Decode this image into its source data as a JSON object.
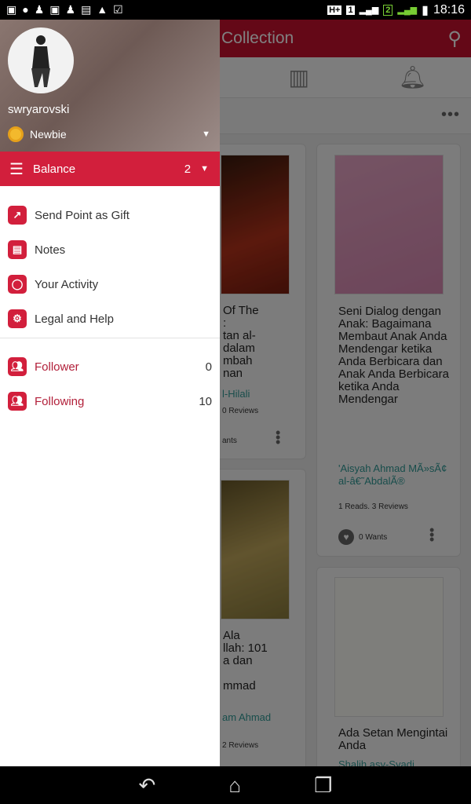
{
  "status_bar": {
    "time": "18:16",
    "network": "H+",
    "sim1": "1",
    "sim2": "2"
  },
  "app": {
    "title": "Collection",
    "tabs": [
      "home-icon",
      "chart-icon",
      "bell-icon"
    ]
  },
  "books": [
    {
      "title_lines": [
        "Of The",
        ":",
        "tan al-",
        "dalam",
        "mbah",
        "nan"
      ],
      "author": "l-Hilali",
      "meta": "0 Reviews",
      "wants": "ants"
    },
    {
      "title": "Seni Dialog dengan Anak: Bagaimana Membaut Anak Anda Mendengar ketika Anda Berbicara dan Anak Anda Berbicara ketika Anda Mendengar",
      "author": "'Aisyah Ahmad MÃ»sÃ¢ al-â€˜AbdalÃ®",
      "meta": "1 Reads. 3 Reviews",
      "wants": "0 Wants"
    },
    {
      "title_lines": [
        "Ala",
        "llah: 101",
        "a dan",
        "",
        "mmad"
      ],
      "author": "am Ahmad",
      "meta": "2 Reviews"
    },
    {
      "title": "Ada Setan Mengintai Anda",
      "author": "Shalih asy-Syadi"
    }
  ],
  "drawer": {
    "username": "swryarovski",
    "rank": "Newbie",
    "balance_label": "Balance",
    "balance_value": "2",
    "menu": [
      {
        "label": "Send Point as Gift",
        "icon": "arrow-up-right-icon"
      },
      {
        "label": "Notes",
        "icon": "notes-icon"
      },
      {
        "label": "Your Activity",
        "icon": "activity-icon"
      },
      {
        "label": "Legal and Help",
        "icon": "gear-icon"
      }
    ],
    "social": [
      {
        "label": "Follower",
        "count": "0"
      },
      {
        "label": "Following",
        "count": "10"
      }
    ]
  },
  "colors": {
    "accent": "#d21f3c",
    "author": "#3fa7a3"
  }
}
